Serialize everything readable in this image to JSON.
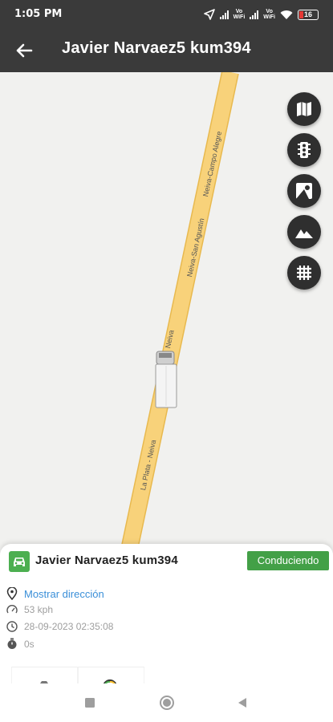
{
  "status_bar": {
    "time": "1:05 PM",
    "net1": "Vo\nWiFi",
    "net2": "Vo\nWiFi",
    "battery": "16",
    "icons": [
      "location-arrow-icon",
      "signal-icon",
      "signal-icon",
      "wifi-icon",
      "battery-icon"
    ]
  },
  "header": {
    "title": "Javier Narvaez5 kum394",
    "back_icon": "arrow-left-icon"
  },
  "map": {
    "road_labels": [
      "Neiva-Campo Alegre",
      "Neiva-San Agustín",
      "Neiva",
      "La Plata - Neiva"
    ],
    "controls": [
      "map-layers-icon",
      "traffic-light-icon",
      "street-view-icon",
      "terrain-icon",
      "grid-icon"
    ],
    "colors": {
      "road": "#f8d27a",
      "road_edge": "#e8b94f",
      "background": "#f1f1ef"
    }
  },
  "vehicle": {
    "name": "Javier Narvaez5 kum394",
    "status": "Conduciendo",
    "address_link": "Mostrar dirección",
    "speed": "53 kph",
    "datetime": "28-09-2023 02:35:08",
    "duration": "0s",
    "colors": {
      "status": "#43a047",
      "link": "#3a8fd8"
    }
  },
  "nav": {
    "icons": [
      "recent-apps-icon",
      "home-icon",
      "back-icon"
    ]
  }
}
